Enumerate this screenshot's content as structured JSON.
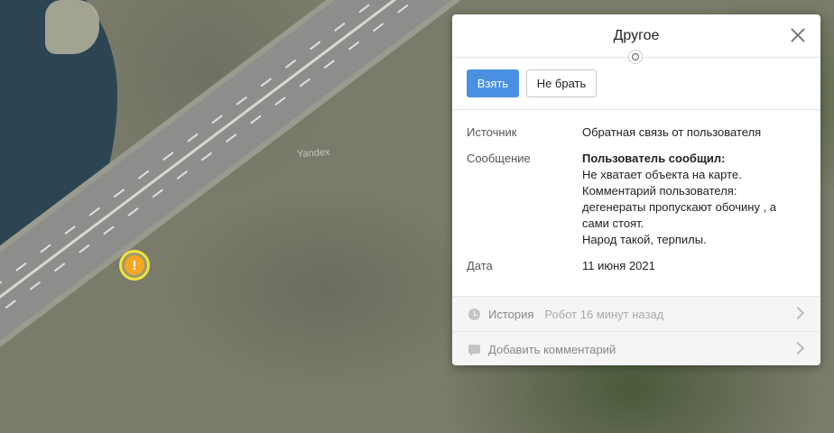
{
  "map": {
    "watermark": "Yandex"
  },
  "panel": {
    "title": "Другое",
    "take_label": "Взять",
    "skip_label": "Не брать",
    "fields": {
      "source_label": "Источник",
      "source_value": "Обратная связь от пользователя",
      "message_label": "Сообщение",
      "message_title": "Пользователь сообщил:",
      "message_lines": [
        "Не хватает объекта на карте.",
        "Комментарий пользователя:",
        "дегенераты пропускают обочину , а сами стоят.",
        "Народ такой, терпилы."
      ],
      "date_label": "Дата",
      "date_value": "11 июня 2021"
    },
    "history": {
      "label": "История",
      "meta": "Робот 16 минут назад"
    },
    "comment": {
      "label": "Добавить комментарий"
    }
  }
}
